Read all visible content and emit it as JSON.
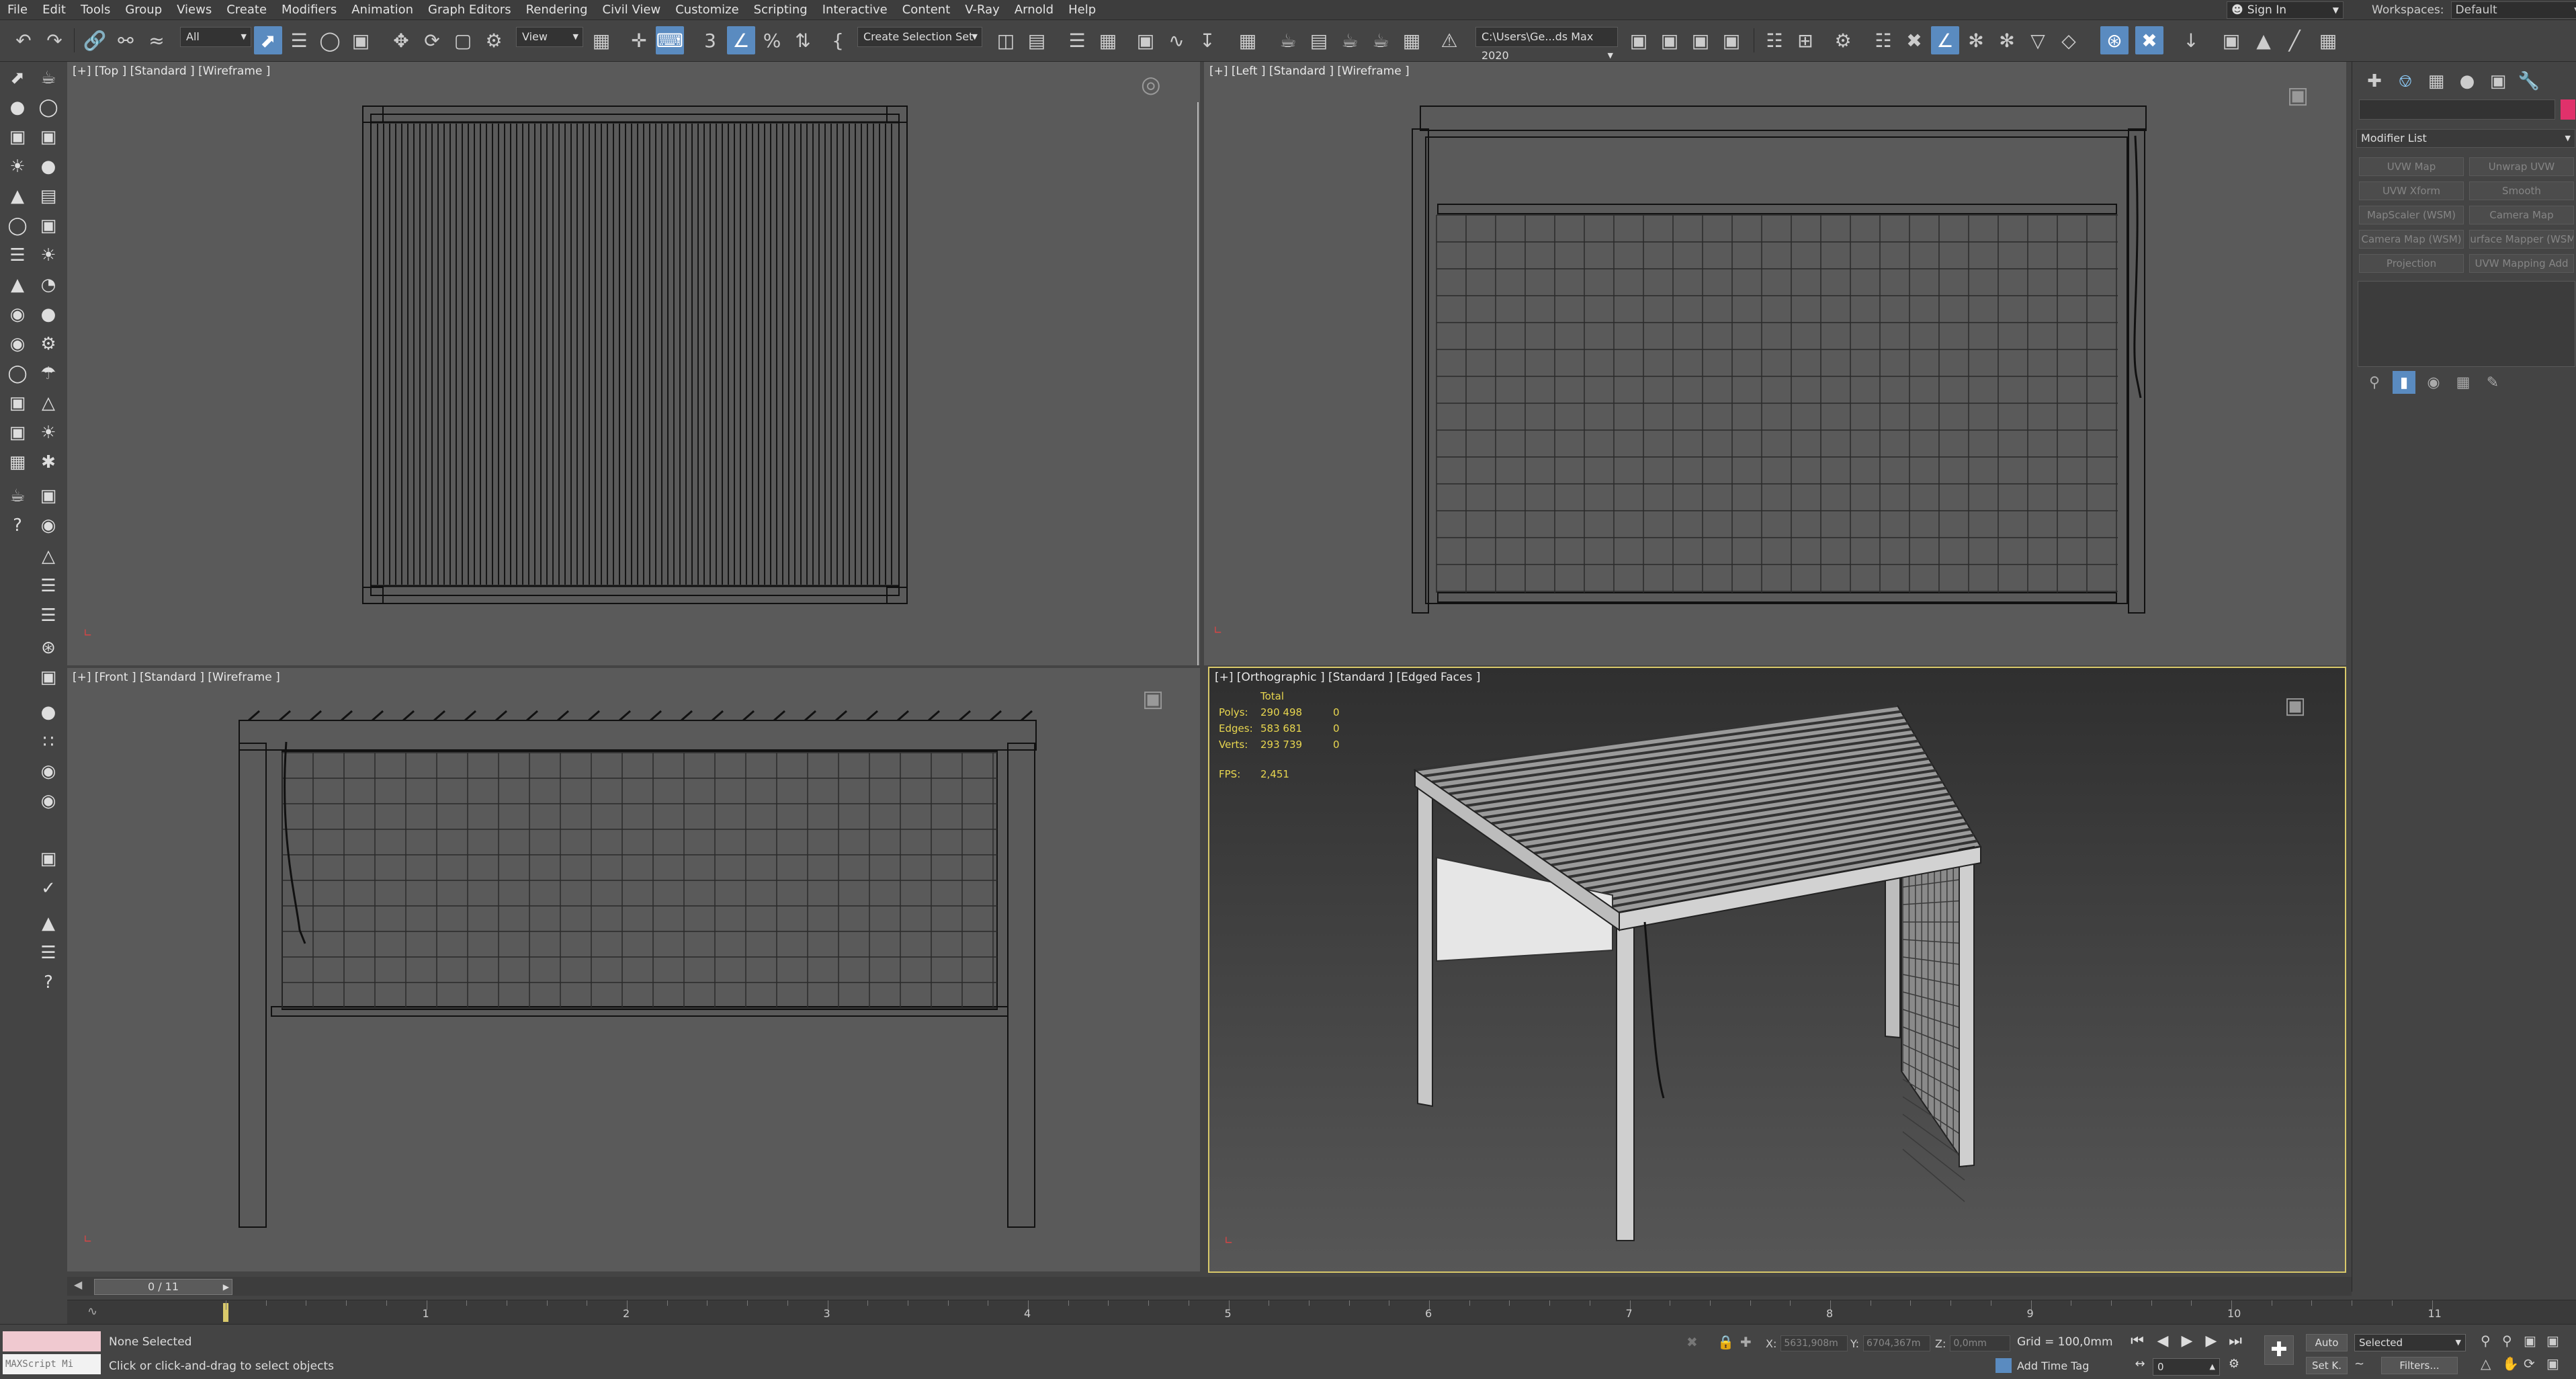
{
  "menu": [
    "File",
    "Edit",
    "Tools",
    "Group",
    "Views",
    "Create",
    "Modifiers",
    "Animation",
    "Graph Editors",
    "Rendering",
    "Civil View",
    "Customize",
    "Scripting",
    "Interactive",
    "Content",
    "V-Ray",
    "Arnold",
    "Help"
  ],
  "signin": {
    "label": "Sign In"
  },
  "workspaces": {
    "label": "Workspaces:",
    "value": "Default"
  },
  "toolbar": {
    "filter": "All",
    "refcoord": "View",
    "selection_set": "Create Selection Set",
    "project_path": "C:\\Users\\Ge...ds Max 2020"
  },
  "viewports": {
    "top": {
      "label": "[+] [Top ] [Standard ] [Wireframe ]"
    },
    "left": {
      "label": "[+] [Left ] [Standard ] [Wireframe ]"
    },
    "front": {
      "label": "[+] [Front ] [Standard ] [Wireframe ]"
    },
    "persp": {
      "label": "[+] [Orthographic ] [Standard ] [Edged Faces ]"
    }
  },
  "stats": {
    "header": "Total",
    "rows": [
      {
        "label": "Polys:",
        "total": "290 498",
        "sel": "0"
      },
      {
        "label": "Edges:",
        "total": "583 681",
        "sel": "0"
      },
      {
        "label": "Verts:",
        "total": "293 739",
        "sel": "0"
      }
    ],
    "fps_label": "FPS:",
    "fps_value": "2,451"
  },
  "command_panel": {
    "modifier_list": "Modifier List",
    "buttons": [
      "UVW Map",
      "Unwrap UVW",
      "UVW Xform",
      "Smooth",
      "MapScaler (WSM)",
      "Camera Map",
      "Camera Map (WSM)",
      "Surface Mapper (WSM)",
      "Projection",
      "UVW Mapping Add"
    ]
  },
  "timeline": {
    "frame_display": "0 / 11",
    "ticks": [
      "1",
      "2",
      "3",
      "4",
      "5",
      "6",
      "7",
      "8",
      "9",
      "10",
      "11"
    ]
  },
  "status": {
    "maxscript_placeholder": "MAXScript Mi",
    "selection": "None Selected",
    "prompt": "Click or click-and-drag to select objects",
    "x_label": "X:",
    "x_value": "5631,908m",
    "y_label": "Y:",
    "y_value": "6704,367m",
    "z_label": "Z:",
    "z_value": "0,0mm",
    "grid": "Grid = 100,0mm",
    "add_time_tag": "Add Time Tag",
    "auto_key": "Auto",
    "set_key": "Set K.",
    "key_filter": "Selected",
    "filters": "Filters...",
    "frame": "0"
  },
  "colors": {
    "accent": "#5a8bc0",
    "active_viewport": "#d9c96a",
    "stats": "#e8d64f",
    "object_color": "#e0316b"
  }
}
